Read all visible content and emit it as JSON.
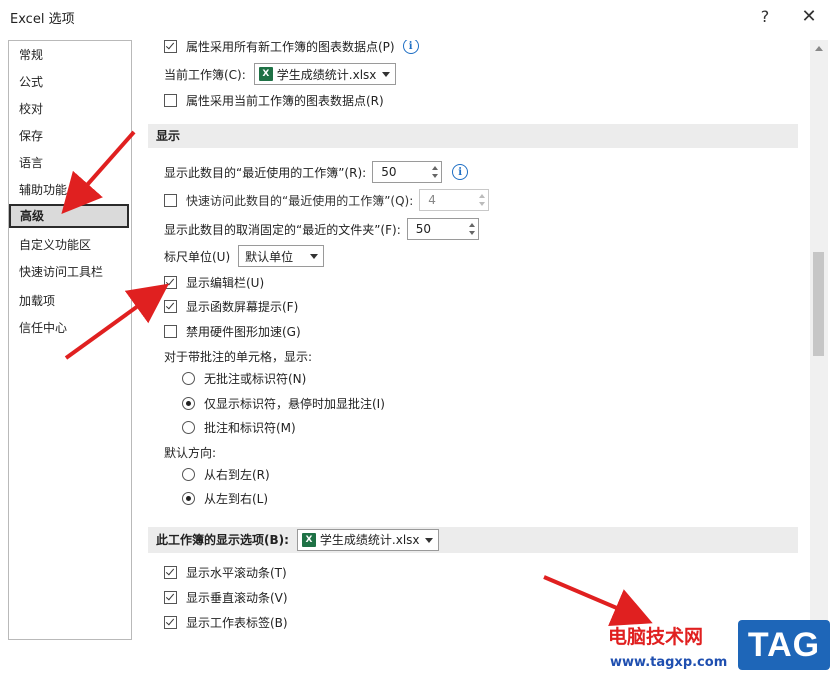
{
  "window": {
    "title": "Excel 选项",
    "help": "?",
    "close": "✕"
  },
  "sidebar": {
    "items": [
      {
        "label": "常规"
      },
      {
        "label": "公式"
      },
      {
        "label": "校对"
      },
      {
        "label": "保存"
      },
      {
        "label": "语言"
      },
      {
        "label": "辅助功能"
      },
      {
        "label": "高级",
        "selected": true
      },
      {
        "label": "自定义功能区"
      },
      {
        "label": "快速访问工具栏"
      },
      {
        "label": "加载项"
      },
      {
        "label": "信任中心"
      }
    ]
  },
  "main": {
    "chart_points_all": {
      "label": "属性采用所有新工作簿的图表数据点(P)",
      "checked": true
    },
    "current_workbook": {
      "label": "当前工作簿(C):",
      "value": "学生成绩统计.xlsx"
    },
    "chart_points_current": {
      "label": "属性采用当前工作簿的图表数据点(R)",
      "checked": false
    },
    "display_section": {
      "title": "显示"
    },
    "recent_workbooks": {
      "label": "显示此数目的“最近使用的工作簿”(R):",
      "value": "50"
    },
    "quick_access_recent": {
      "label": "快速访问此数目的“最近使用的工作簿”(Q):",
      "value": "4",
      "checked": false
    },
    "unpinned_folders": {
      "label": "显示此数目的取消固定的“最近的文件夹”(F):",
      "value": "50"
    },
    "ruler_units": {
      "label": "标尺单位(U)",
      "value": "默认单位"
    },
    "show_formula_bar": {
      "label": "显示编辑栏(U)",
      "checked": true
    },
    "show_function_tips": {
      "label": "显示函数屏幕提示(F)",
      "checked": true
    },
    "disable_hw_accel": {
      "label": "禁用硬件图形加速(G)",
      "checked": false
    },
    "comments_label": "对于带批注的单元格，显示:",
    "comment_options": [
      {
        "label": "无批注或标识符(N)",
        "selected": false
      },
      {
        "label": "仅显示标识符，悬停时加显批注(I)",
        "selected": true
      },
      {
        "label": "批注和标识符(M)",
        "selected": false
      }
    ],
    "direction_label": "默认方向:",
    "direction_options": [
      {
        "label": "从右到左(R)",
        "selected": false
      },
      {
        "label": "从左到右(L)",
        "selected": true
      }
    ],
    "workbook_section": {
      "title": "此工作簿的显示选项(B):",
      "value": "学生成绩统计.xlsx"
    },
    "show_hscroll": {
      "label": "显示水平滚动条(T)",
      "checked": true
    },
    "show_vscroll": {
      "label": "显示垂直滚动条(V)",
      "checked": true
    },
    "show_sheet_tabs": {
      "label": "显示工作表标签(B)",
      "checked": true
    }
  },
  "watermark": {
    "text": "电脑技术网",
    "url": "www.tagxp.com",
    "tag": "TAG"
  },
  "colors": {
    "accent_arrow": "#e02020",
    "excel_green": "#1e7145",
    "info_blue": "#1f6fc4"
  }
}
